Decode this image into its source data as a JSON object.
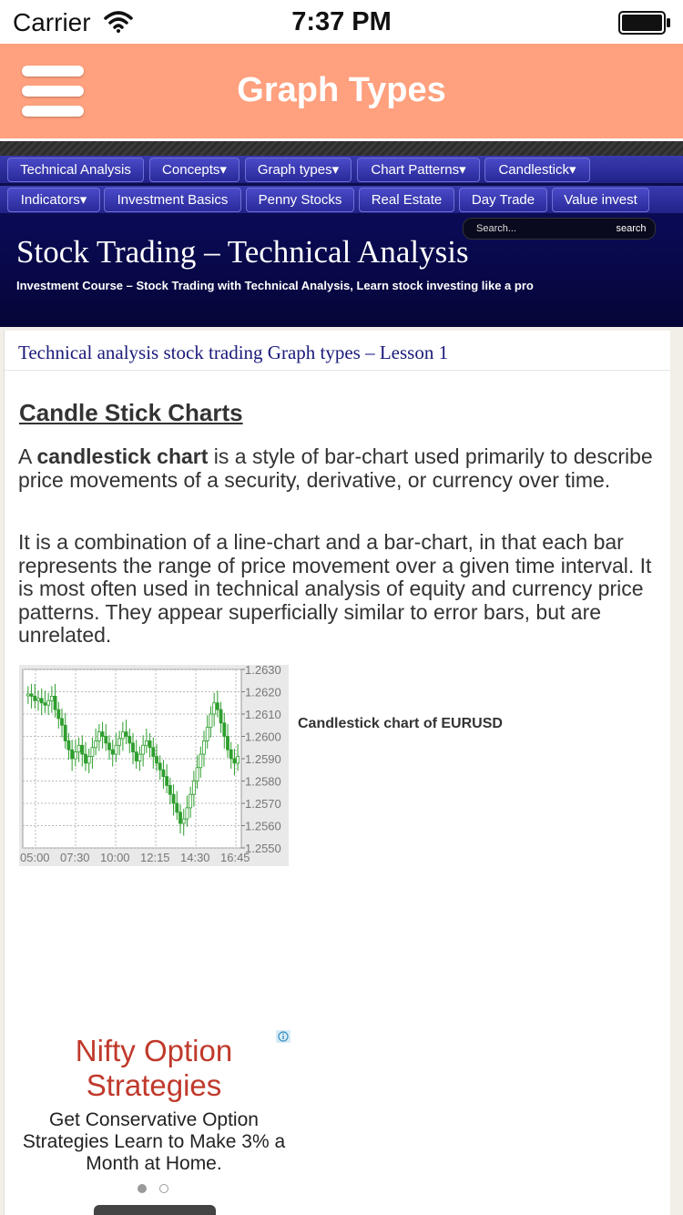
{
  "status_bar": {
    "carrier": "Carrier",
    "time": "7:37 PM"
  },
  "app_header": {
    "title": "Graph Types"
  },
  "nav": {
    "row1": [
      "Technical Analysis",
      "Concepts▾",
      "Graph types▾",
      "Chart Patterns▾",
      "Candlestick▾"
    ],
    "row2": [
      "Indicators▾",
      "Investment Basics",
      "Penny Stocks",
      "Real Estate",
      "Day Trade",
      "Value invest"
    ]
  },
  "search": {
    "placeholder": "Search...",
    "button_label": "search"
  },
  "site": {
    "title": "Stock Trading – Technical Analysis",
    "subtitle": "Investment Course – Stock Trading with Technical Analysis, Learn stock investing like a pro"
  },
  "article": {
    "lesson_title": "Technical analysis stock trading Graph types – Lesson 1",
    "heading": "Candle Stick Charts",
    "p1_prefix": "A ",
    "p1_bold": "candlestick chart",
    "p1_rest": " is a style of bar-chart used primarily to describe price movements of a security, derivative, or currency over time.",
    "p2": "It is a combination of a line-chart and a bar-chart, in that each bar represents the range of price movement over a given time interval. It is most often used in technical analysis of equity and currency price patterns. They appear superficially similar to error bars, but are unrelated.",
    "chart_caption": "Candlestick chart of EURUSD"
  },
  "chart_data": {
    "type": "candlestick",
    "title": "",
    "xlabel": "",
    "ylabel": "",
    "x_ticks": [
      "05:00",
      "07:30",
      "10:00",
      "12:15",
      "14:30",
      "16:45"
    ],
    "y_ticks": [
      "1.2630",
      "1.2620",
      "1.2610",
      "1.2600",
      "1.2590",
      "1.2580",
      "1.2570",
      "1.2560",
      "1.2550"
    ],
    "ylim": [
      1.255,
      1.263
    ],
    "grid": true,
    "color": "#2e9e2e",
    "close_series": [
      1.2619,
      1.2618,
      1.2616,
      1.2617,
      1.2615,
      1.2614,
      1.2616,
      1.2618,
      1.2612,
      1.2608,
      1.2605,
      1.2598,
      1.2594,
      1.259,
      1.2593,
      1.2596,
      1.2592,
      1.2588,
      1.2591,
      1.2595,
      1.2598,
      1.2602,
      1.26,
      1.2597,
      1.2594,
      1.2592,
      1.2596,
      1.2599,
      1.2602,
      1.26,
      1.2597,
      1.2593,
      1.2589,
      1.2592,
      1.2596,
      1.2598,
      1.2595,
      1.2591,
      1.2588,
      1.2585,
      1.2582,
      1.2578,
      1.2574,
      1.257,
      1.2566,
      1.2561,
      1.2563,
      1.2568,
      1.2574,
      1.258,
      1.2586,
      1.2592,
      1.2598,
      1.2604,
      1.261,
      1.2615,
      1.2612,
      1.2606,
      1.26,
      1.2594,
      1.259,
      1.2588,
      1.2591
    ]
  },
  "ad": {
    "title": "Nifty Option Strategies",
    "text": "Get Conservative Option Strategies Learn to Make 3% a Month at Home."
  },
  "colors": {
    "header": "#ffa07e",
    "nav": "#2a2a9a",
    "lesson_title": "#1a1a7a",
    "ad_title": "#c0392b"
  }
}
